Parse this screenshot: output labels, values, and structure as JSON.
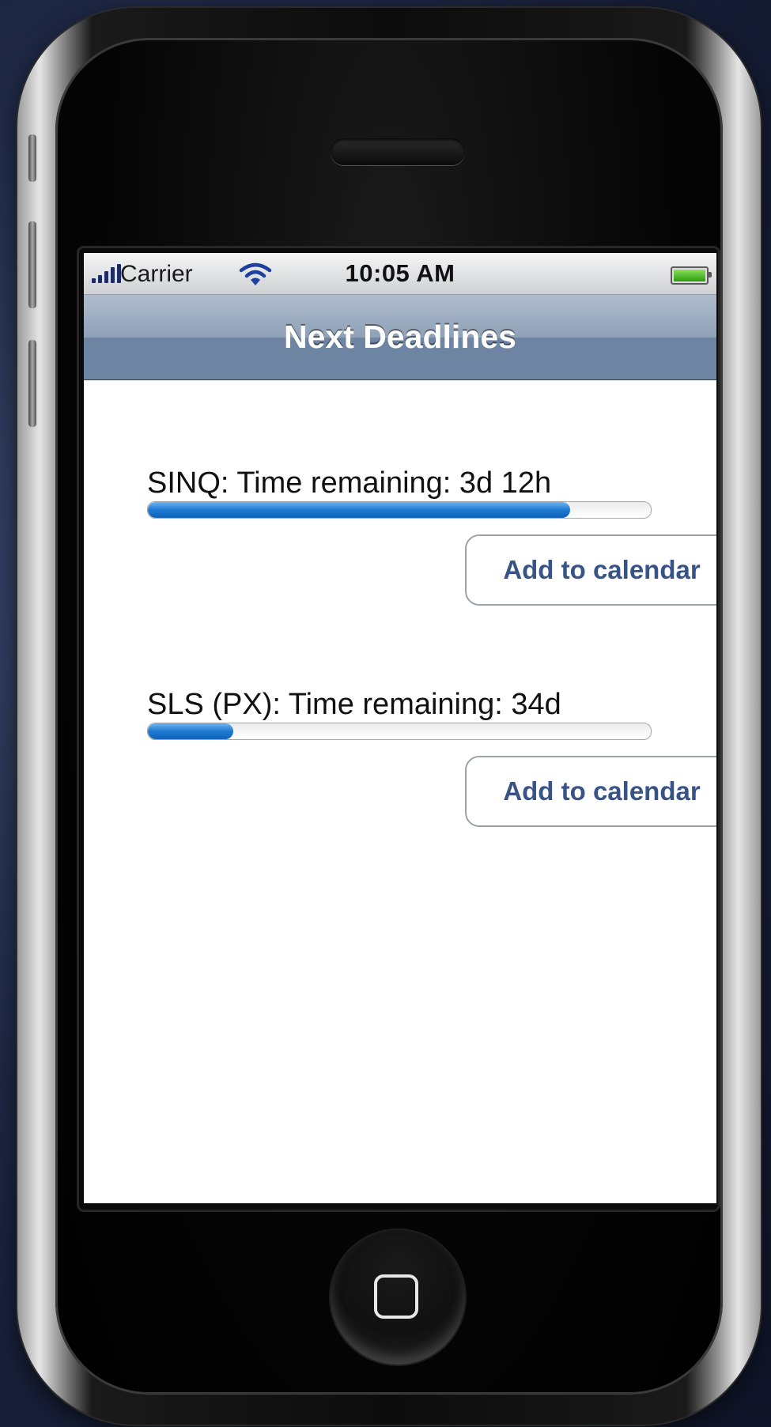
{
  "status_bar": {
    "carrier": "Carrier",
    "time": "10:05 AM",
    "signal_icon": "signal-bars-icon",
    "wifi_icon": "wifi-icon",
    "battery_icon": "battery-icon",
    "battery_level": 1.0
  },
  "nav": {
    "title": "Next Deadlines"
  },
  "deadlines": [
    {
      "label": "SINQ: Time remaining: 3d 12h",
      "progress": 0.84,
      "button_label": "Add to calendar"
    },
    {
      "label": "SLS (PX): Time remaining: 34d",
      "progress": 0.17,
      "button_label": "Add to calendar"
    }
  ],
  "colors": {
    "nav_bar": "#6d84a2",
    "progress_fill": "#1e7ad3",
    "button_text": "#385487"
  },
  "device": {
    "home_icon": "home-button-icon",
    "speaker_icon": "earpiece-speaker"
  }
}
